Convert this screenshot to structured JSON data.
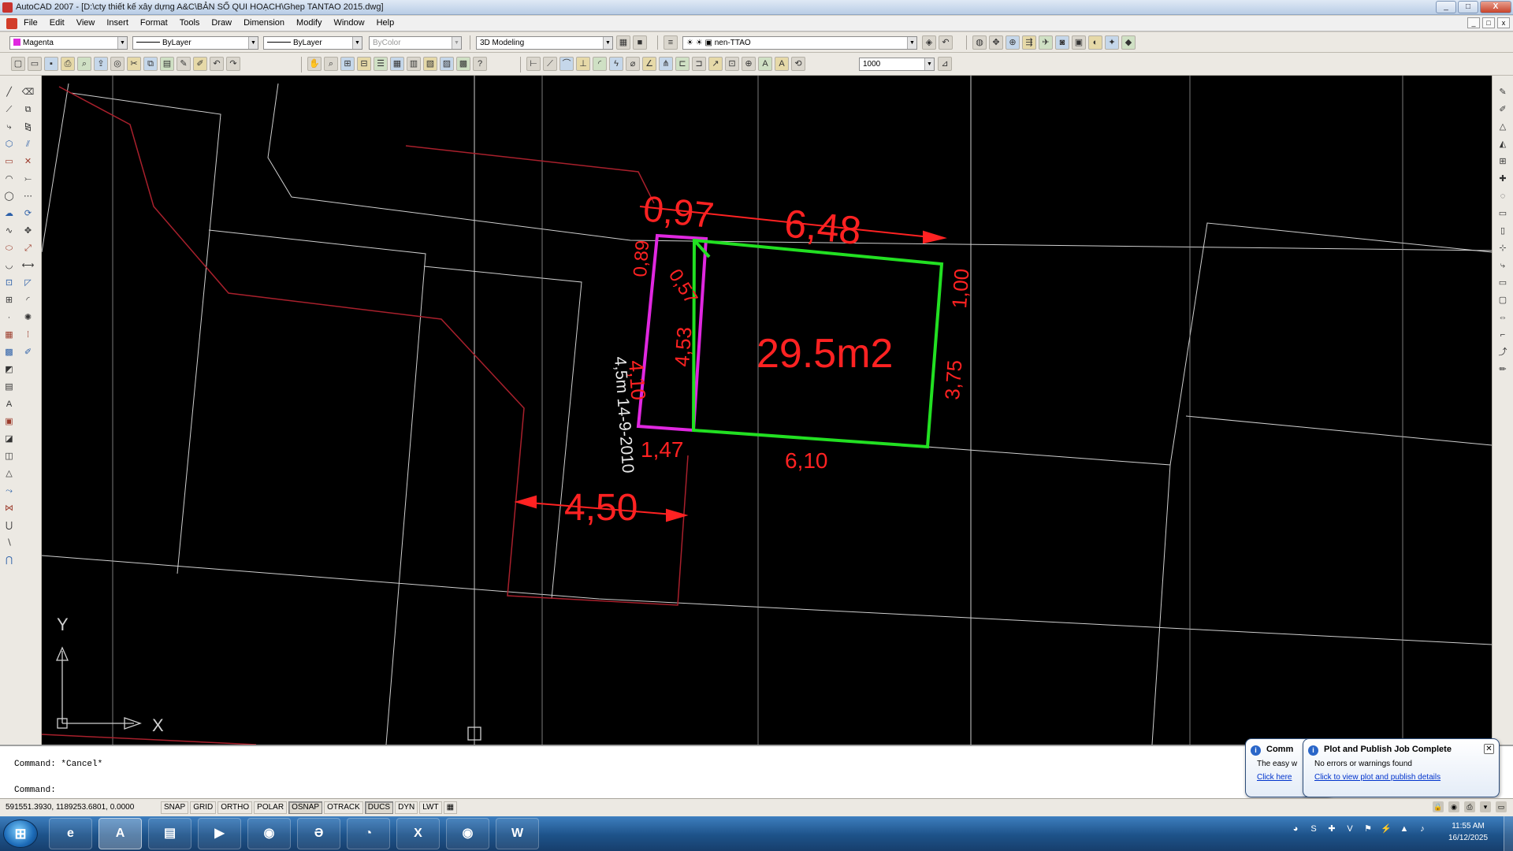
{
  "window": {
    "title": "AutoCAD 2007 - [D:\\cty thiết kế xây dựng A&C\\BẢN SỐ QUI HOẠCH\\Ghep TANTAO 2015.dwg]",
    "buttons": [
      "_",
      "□",
      "X"
    ],
    "mdi_buttons": [
      "_",
      "□",
      "x"
    ]
  },
  "menu": {
    "items": [
      "File",
      "Edit",
      "View",
      "Insert",
      "Format",
      "Tools",
      "Draw",
      "Dimension",
      "Modify",
      "Window",
      "Help"
    ]
  },
  "properties_toolbar": {
    "color": "Magenta",
    "linetype": "ByLayer",
    "lineweight": "ByLayer",
    "plotstyle": "ByColor",
    "workspace": "3D Modeling",
    "layer": "nen-TTAO",
    "scale": "1000"
  },
  "drawing": {
    "dimensions": {
      "top_left": "0,97",
      "top": "6,48",
      "left_top": "0,89",
      "diagonal": "0,57",
      "right_top": "1,00",
      "left": "4,10",
      "inner": "4,53",
      "right": "3,75",
      "bottom_left": "1,47",
      "bottom": "6,10",
      "road_width": "4,50"
    },
    "area": "29.5m2",
    "road_note": "4,5m 14-9-2010",
    "ucs": {
      "y": "Y",
      "x": "X"
    },
    "colors": {
      "background": "#000000",
      "lot_outline": "#22e022",
      "lot_strip": "#e028e0",
      "dimension_text": "#ff2222",
      "parcel_lines": "#cfcfcf",
      "road_lines": "#a8202c"
    }
  },
  "command": {
    "history": "Command: *Cancel*",
    "prompt": "Command:"
  },
  "status": {
    "coordinates": "591551.3930, 1189253.6801, 0.0000",
    "toggles": [
      {
        "label": "SNAP",
        "on": false
      },
      {
        "label": "GRID",
        "on": false
      },
      {
        "label": "ORTHO",
        "on": false
      },
      {
        "label": "POLAR",
        "on": false
      },
      {
        "label": "OSNAP",
        "on": true
      },
      {
        "label": "OTRACK",
        "on": false
      },
      {
        "label": "DUCS",
        "on": true
      },
      {
        "label": "DYN",
        "on": false
      },
      {
        "label": "LWT",
        "on": false
      }
    ]
  },
  "notifications": {
    "back": {
      "title": "Comm",
      "text": "The easy w",
      "link": "Click here"
    },
    "front": {
      "title": "Plot and Publish Job Complete",
      "text": "No errors or warnings found",
      "link": "Click to view plot and publish details"
    }
  },
  "taskbar": {
    "start_icon": "windows-orb",
    "pins": [
      {
        "name": "ie-icon",
        "glyph": "e",
        "active": false
      },
      {
        "name": "autocad-icon",
        "glyph": "A",
        "active": true
      },
      {
        "name": "explorer-icon",
        "glyph": "▤",
        "active": false
      },
      {
        "name": "media-player-icon",
        "glyph": "▶",
        "active": false
      },
      {
        "name": "chrome-icon",
        "glyph": "◉",
        "active": false
      },
      {
        "name": "app-icon",
        "glyph": "Ə",
        "active": false
      },
      {
        "name": "paint-icon",
        "glyph": "◔",
        "active": false
      },
      {
        "name": "excel-icon",
        "glyph": "X",
        "active": false
      },
      {
        "name": "chrome-icon",
        "glyph": "◉",
        "active": false
      },
      {
        "name": "word-icon",
        "glyph": "W",
        "active": false
      }
    ],
    "time": "11:55 AM",
    "date": "16/12/2025"
  }
}
